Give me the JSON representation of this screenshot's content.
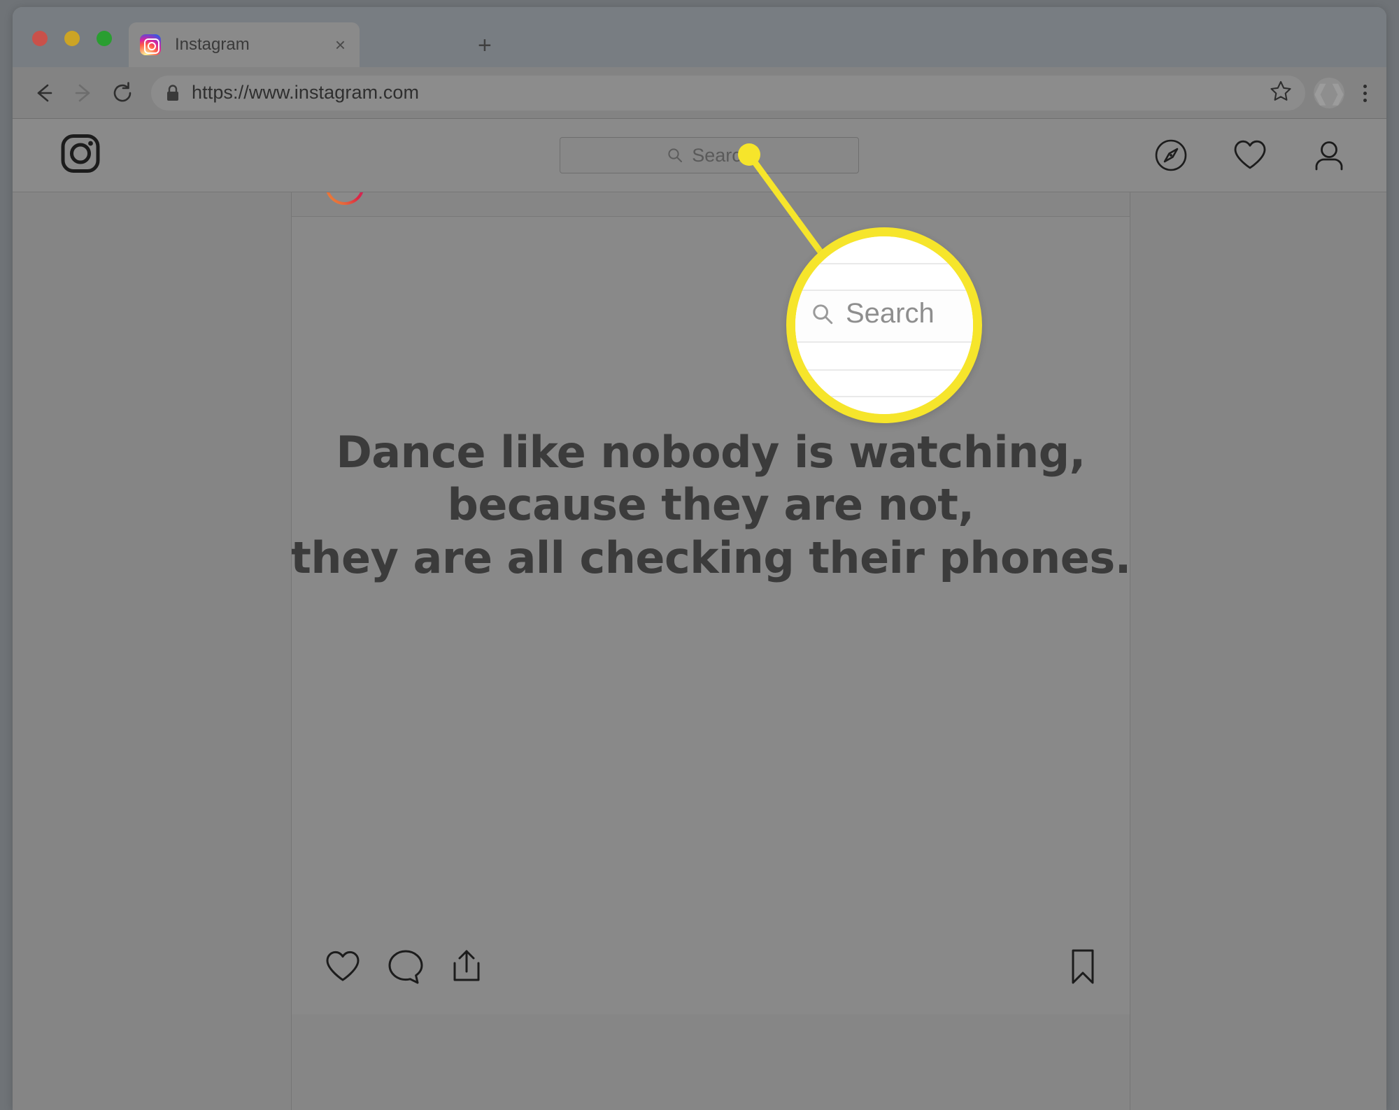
{
  "browser": {
    "window_controls": [
      {
        "name": "close",
        "color": "#c9514a"
      },
      {
        "name": "minimize",
        "color": "#ccA425"
      },
      {
        "name": "maximize",
        "color": "#2a9e31"
      }
    ],
    "tab": {
      "title": "Instagram",
      "favicon": "instagram-favicon",
      "close_label": "×"
    },
    "new_tab_label": "+",
    "back_icon": "back-arrow-icon",
    "forward_icon": "forward-arrow-icon",
    "reload_icon": "reload-icon",
    "url": "https://www.instagram.com",
    "lock_icon": "padlock-icon",
    "bookmark_icon": "star-icon",
    "profile_icon": "profile-avatar-icon",
    "menu_icon": "kebab-menu-icon"
  },
  "instagram": {
    "logo": "instagram-camera-logo",
    "search": {
      "placeholder": "Search",
      "icon": "magnifier-icon"
    },
    "nav_icons": [
      {
        "name": "explore-compass-icon",
        "label": "Explore"
      },
      {
        "name": "activity-heart-icon",
        "label": "Activity"
      },
      {
        "name": "profile-person-icon",
        "label": "Profile"
      }
    ],
    "post": {
      "more_options": "•••",
      "quote_lines": [
        "Dance like nobody is watching,",
        "because they are not,",
        "they are all checking their phones."
      ],
      "actions": [
        {
          "name": "like-heart-icon",
          "label": "Like"
        },
        {
          "name": "comment-bubble-icon",
          "label": "Comment"
        },
        {
          "name": "share-icon",
          "label": "Share"
        },
        {
          "name": "save-bookmark-icon",
          "label": "Save"
        }
      ]
    }
  },
  "callout": {
    "highlight_color": "#F6E52B",
    "magnified_label": "Search",
    "magnified_icon": "magnifier-icon"
  }
}
